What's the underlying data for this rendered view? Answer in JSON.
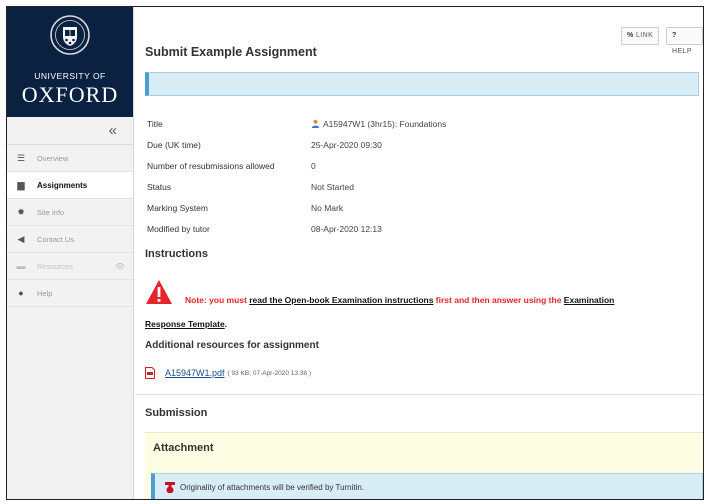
{
  "sidebar": {
    "brand_line1": "UNIVERSITY OF",
    "brand_line2": "OXFORD",
    "collapse_glyph": "«",
    "items": [
      {
        "label": "Overview",
        "icon": "list-icon",
        "glyph": "☰",
        "state": "normal"
      },
      {
        "label": "Assignments",
        "icon": "assignment-icon",
        "glyph": "▆",
        "state": "active"
      },
      {
        "label": "Site info",
        "icon": "gear-icon",
        "glyph": "✹",
        "state": "normal"
      },
      {
        "label": "Contact Us",
        "icon": "send-icon",
        "glyph": "◀",
        "state": "normal"
      },
      {
        "label": "Resources",
        "icon": "folder-icon",
        "glyph": "▬",
        "state": "disabled"
      },
      {
        "label": "Help",
        "icon": "help-icon",
        "glyph": "●",
        "state": "normal"
      }
    ],
    "hidden_glyph": "👁"
  },
  "toolbar": {
    "link_label": "LINK",
    "link_icon_glyph": "%",
    "help_label": "HELP",
    "help_icon_glyph": "?"
  },
  "page_title": "Submit Example Assignment",
  "properties": [
    {
      "label": "Title",
      "value": "A15947W1 (3hr15): Foundations"
    },
    {
      "label": "Due (UK time)",
      "value": "25-Apr-2020 09:30"
    },
    {
      "label": "Number of resubmissions allowed",
      "value": "0"
    },
    {
      "label": "Status",
      "value": "Not Started"
    },
    {
      "label": "Marking System",
      "value": "No Mark"
    },
    {
      "label": "Modified by tutor",
      "value": "08-Apr-2020 12:13"
    }
  ],
  "instructions": {
    "heading": "Instructions",
    "note_prefix": "Note: you must ",
    "note_link1": "read the Open-book Examination instructions",
    "note_middle": " first and then answer using the ",
    "note_link2a": "Examination",
    "note_link2b": "Response Template",
    "note_end": "."
  },
  "resources": {
    "heading": "Additional resources for assignment",
    "file_name": "A15947W1.pdf",
    "file_meta": "( 93 KB; 07-Apr-2020 13:38 )"
  },
  "submission": {
    "heading": "Submission",
    "attachment_heading": "Attachment",
    "turnitin_text": "Originality of attachments will be verified by Turnitin."
  },
  "colors": {
    "brand_navy": "#0b2142",
    "alert_red": "#e5252a",
    "info_blue": "#d9edf7",
    "attachment_yellow": "#fdfde4"
  }
}
